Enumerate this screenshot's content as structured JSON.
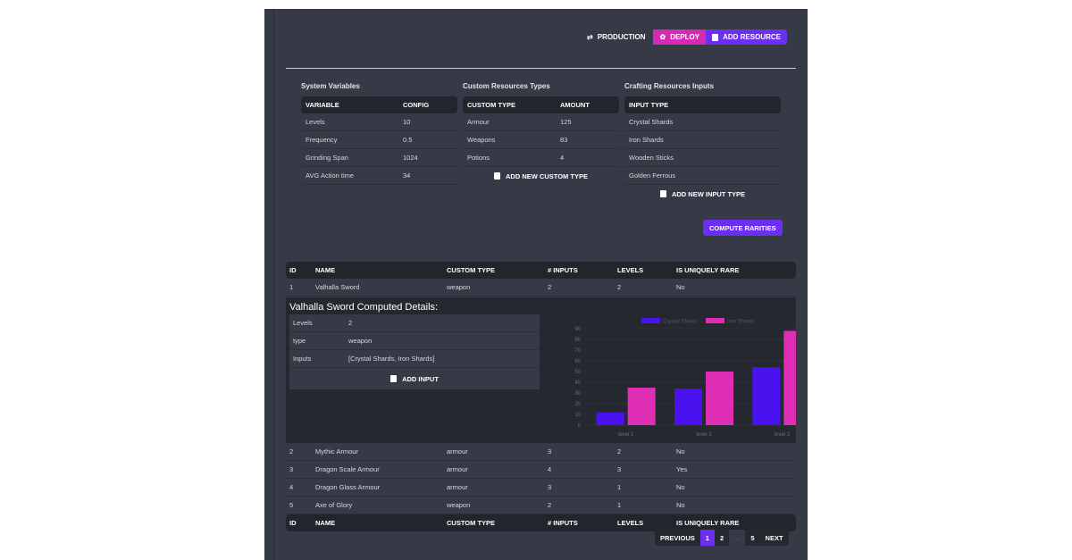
{
  "toolbar": {
    "production": "PRODUCTION",
    "deploy": "DEPLOY",
    "add_resource": "ADD RESOURCE"
  },
  "colors": {
    "deploy": "#d62ab4",
    "add_resource": "#6a2ff0",
    "crystal": "#4b12f0",
    "iron": "#de2eb4"
  },
  "system": {
    "title": "System Variables",
    "headers": [
      "VARIABLE",
      "CONFIG"
    ],
    "rows": [
      [
        "Levels",
        "10"
      ],
      [
        "Frequency",
        "0.5"
      ],
      [
        "Grinding Span",
        "1024"
      ],
      [
        "AVG Action time",
        "34"
      ]
    ]
  },
  "custom": {
    "title": "Custom Resources Types",
    "headers": [
      "CUSTOM TYPE",
      "AMOUNT"
    ],
    "rows": [
      [
        "Armour",
        "125"
      ],
      [
        "Weapons",
        "83"
      ],
      [
        "Potions",
        "4"
      ]
    ],
    "add": "ADD NEW CUSTOM TYPE"
  },
  "crafting": {
    "title": "Crafting Resources Inputs",
    "headers": [
      "INPUT TYPE"
    ],
    "rows": [
      [
        "Crystal Shards"
      ],
      [
        "Iron Shards"
      ],
      [
        "Wooden Sticks"
      ],
      [
        "Golden Ferrous"
      ]
    ],
    "add": "ADD NEW INPUT TYPE"
  },
  "compute": "COMPUTE RARITIES",
  "table": {
    "headers": [
      "ID",
      "NAME",
      "CUSTOM TYPE",
      "# INPUTS",
      "LEVELS",
      "IS UNIQUELY RARE"
    ],
    "first": [
      "1",
      "Valhalla Sword",
      "weapon",
      "2",
      "2",
      "No"
    ],
    "rows": [
      [
        "2",
        "Mythic Armour",
        "armour",
        "3",
        "2",
        "No"
      ],
      [
        "3",
        "Dragon Scale Armour",
        "armour",
        "4",
        "3",
        "Yes"
      ],
      [
        "4",
        "Dragon Glass Armour",
        "armour",
        "3",
        "1",
        "No"
      ],
      [
        "5",
        "Axe of Glory",
        "weapon",
        "2",
        "1",
        "No"
      ]
    ]
  },
  "detail": {
    "title": "Valhalla Sword Computed Details:",
    "rows": [
      [
        "Levels",
        "2"
      ],
      [
        "type",
        "weapon"
      ],
      [
        "Inputs",
        "[Crystal Shards, Iron Shards]"
      ]
    ],
    "add": "ADD INPUT"
  },
  "pagination": {
    "previous": "PREVIOUS",
    "pages": [
      "1",
      "2",
      "...",
      "5"
    ],
    "next": "NEXT",
    "current": "1"
  },
  "chart_data": {
    "type": "bar",
    "categories": [
      "level 1",
      "level 2",
      "level 3"
    ],
    "series": [
      {
        "name": "Crystal Shards",
        "values": [
          12,
          34,
          54
        ]
      },
      {
        "name": "Iron Shards",
        "values": [
          35,
          50,
          88
        ]
      }
    ],
    "ylim": [
      0,
      90
    ],
    "yticks": [
      0,
      10,
      20,
      30,
      40,
      50,
      60,
      70,
      80,
      90
    ],
    "legend": "top",
    "grid": true
  }
}
